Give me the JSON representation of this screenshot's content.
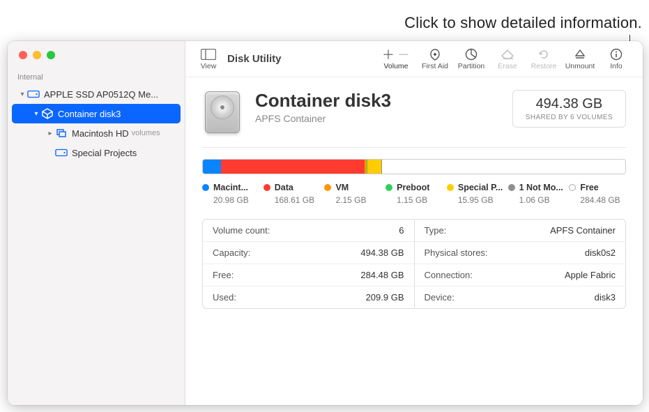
{
  "callout": "Click to show detailed information.",
  "sidebar": {
    "section_label": "Internal",
    "items": [
      {
        "label": "APPLE SSD AP0512Q Me...",
        "icon": "disk",
        "indent": 0,
        "disclosure": "down",
        "selected": false,
        "sublabel": ""
      },
      {
        "label": "Container disk3",
        "icon": "container",
        "indent": 1,
        "disclosure": "down",
        "selected": true,
        "sublabel": ""
      },
      {
        "label": "Macintosh HD",
        "icon": "volumes",
        "indent": 2,
        "disclosure": "right",
        "selected": false,
        "sublabel": "volumes"
      },
      {
        "label": "Special Projects",
        "icon": "volume",
        "indent": 2,
        "disclosure": "",
        "selected": false,
        "sublabel": ""
      }
    ]
  },
  "toolbar": {
    "title": "Disk Utility",
    "view_label": "View",
    "volume_label": "Volume",
    "items": [
      {
        "id": "firstaid",
        "label": "First Aid",
        "disabled": false
      },
      {
        "id": "partition",
        "label": "Partition",
        "disabled": false
      },
      {
        "id": "erase",
        "label": "Erase",
        "disabled": true
      },
      {
        "id": "restore",
        "label": "Restore",
        "disabled": true
      },
      {
        "id": "unmount",
        "label": "Unmount",
        "disabled": false
      },
      {
        "id": "info",
        "label": "Info",
        "disabled": false
      }
    ]
  },
  "header": {
    "title": "Container disk3",
    "subtitle": "APFS Container",
    "size": "494.38 GB",
    "size_sub": "SHARED BY 6 VOLUMES"
  },
  "usage": {
    "segments": [
      {
        "name": "Macint...",
        "size": "20.98 GB",
        "color": "#0a84ff",
        "pct": 4.24
      },
      {
        "name": "Data",
        "size": "168.61 GB",
        "color": "#ff3b30",
        "pct": 34.11
      },
      {
        "name": "VM",
        "size": "2.15 GB",
        "color": "#ff9500",
        "pct": 0.43
      },
      {
        "name": "Preboot",
        "size": "1.15 GB",
        "color": "#30d158",
        "pct": 0.23
      },
      {
        "name": "Special P...",
        "size": "15.95 GB",
        "color": "#ffcc00",
        "pct": 3.23
      },
      {
        "name": "1 Not Mo...",
        "size": "1.06 GB",
        "color": "#8e8e93",
        "pct": 0.21
      },
      {
        "name": "Free",
        "size": "284.48 GB",
        "color": "free",
        "pct": 57.55
      }
    ]
  },
  "details": {
    "left": [
      {
        "key": "Volume count:",
        "val": "6"
      },
      {
        "key": "Capacity:",
        "val": "494.38 GB"
      },
      {
        "key": "Free:",
        "val": "284.48 GB"
      },
      {
        "key": "Used:",
        "val": "209.9 GB"
      }
    ],
    "right": [
      {
        "key": "Type:",
        "val": "APFS Container"
      },
      {
        "key": "Physical stores:",
        "val": "disk0s2"
      },
      {
        "key": "Connection:",
        "val": "Apple Fabric"
      },
      {
        "key": "Device:",
        "val": "disk3"
      }
    ]
  }
}
